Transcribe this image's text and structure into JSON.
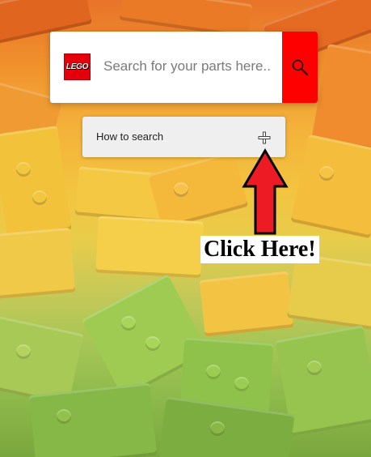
{
  "search": {
    "placeholder": "Search for your parts here..",
    "value": "",
    "button_icon": "search-icon"
  },
  "logo": {
    "text": "LEGO",
    "color": "#e3000b"
  },
  "howto": {
    "label": "How to search",
    "expand_icon": "plus-icon"
  },
  "annotation": {
    "text": "Click Here!",
    "arrow_color": "#ed1c24"
  },
  "colors": {
    "accent_red": "#ff0000",
    "card_bg": "#ffffff",
    "howto_bg": "#efefef"
  }
}
